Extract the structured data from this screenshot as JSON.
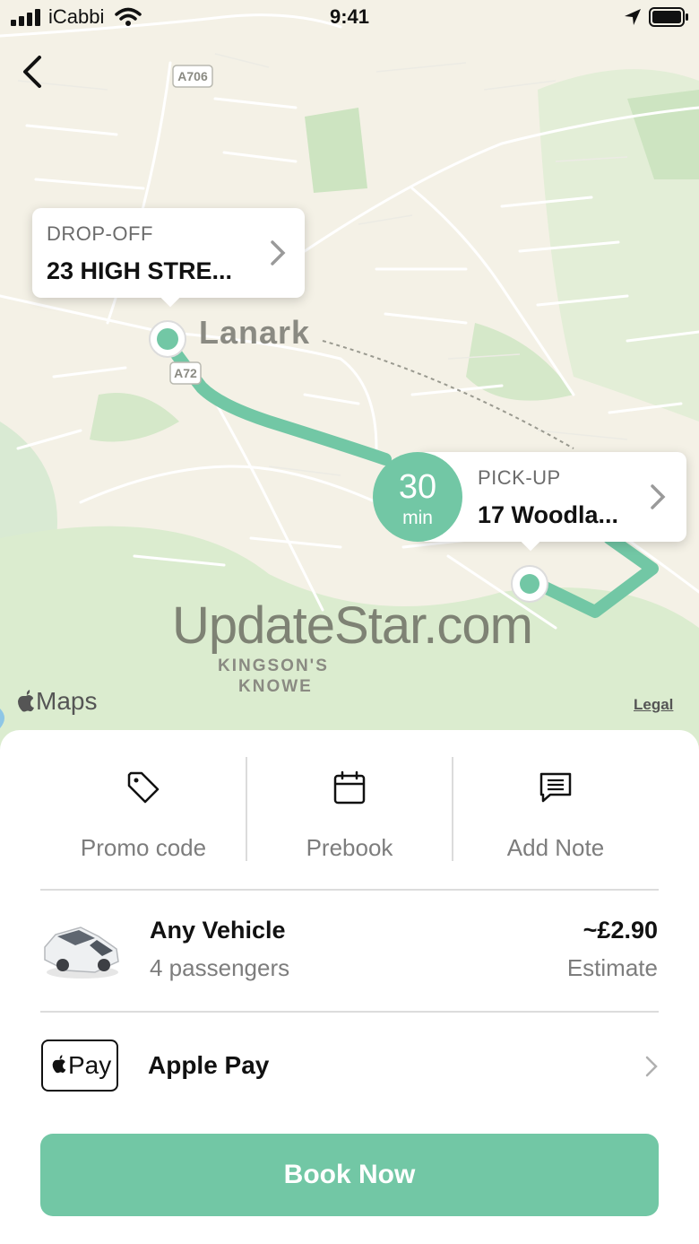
{
  "status_bar": {
    "carrier": "iCabbi",
    "time": "9:41"
  },
  "map": {
    "place_label": "Lanark",
    "district_label_line1": "KINGSON'S",
    "district_label_line2": "KNOWE",
    "road_labels": [
      "A706",
      "A72"
    ],
    "maps_brand": "Maps",
    "legal_link": "Legal",
    "watermark": "UpdateStar.com",
    "route_color": "#72c7a5",
    "drop_off": {
      "label": "DROP-OFF",
      "address": "23 HIGH STRE..."
    },
    "pick_up": {
      "label": "PICK-UP",
      "address": "17 Woodla..."
    },
    "eta": {
      "value": "30",
      "unit": "min"
    }
  },
  "options": [
    {
      "label": "Promo code",
      "icon": "tag-icon"
    },
    {
      "label": "Prebook",
      "icon": "calendar-icon"
    },
    {
      "label": "Add Note",
      "icon": "note-icon"
    }
  ],
  "vehicle": {
    "name": "Any Vehicle",
    "passengers": "4 passengers",
    "price": "~£2.90",
    "price_note": "Estimate",
    "icon": "car-icon"
  },
  "payment": {
    "badge_text": "Pay",
    "method": "Apple Pay"
  },
  "book_button": {
    "label": "Book Now",
    "color": "#72c7a5"
  }
}
